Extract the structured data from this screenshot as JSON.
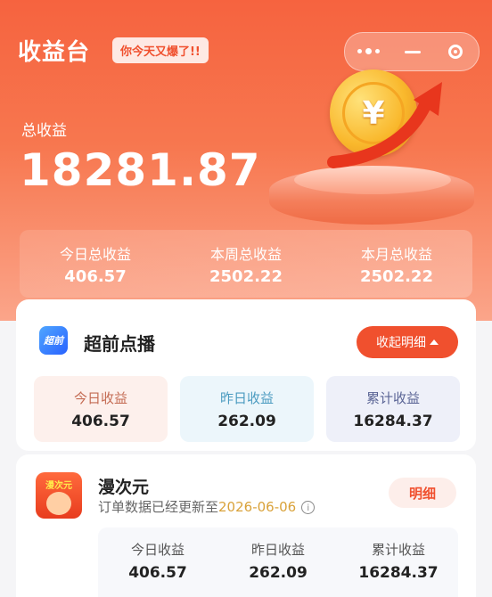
{
  "header": {
    "title": "收益台",
    "slogan": "你今天又爆了!!"
  },
  "capsule": {
    "more_icon": "more-dots-icon",
    "minimize_icon": "minus-icon",
    "close_icon": "target-icon"
  },
  "total": {
    "label": "总收益",
    "value": "18281.87"
  },
  "summary": [
    {
      "label": "今日总收益",
      "value": "406.57"
    },
    {
      "label": "本周总收益",
      "value": "2502.22"
    },
    {
      "label": "本月总收益",
      "value": "2502.22"
    }
  ],
  "card1": {
    "icon_text": "超前",
    "name": "超前点播",
    "button_label": "收起明细",
    "stats": [
      {
        "label": "今日收益",
        "value": "406.57"
      },
      {
        "label": "昨日收益",
        "value": "262.09"
      },
      {
        "label": "累计收益",
        "value": "16284.37"
      }
    ]
  },
  "card2": {
    "icon_text": "漫次元",
    "name": "漫次元",
    "update_text": "订单数据已经更新至",
    "update_date": "2026-06-06",
    "button_label": "明细",
    "stats": [
      {
        "label": "今日收益",
        "value": "406.57"
      },
      {
        "label": "昨日收益",
        "value": "262.09"
      },
      {
        "label": "累计收益",
        "value": "16284.37"
      }
    ]
  },
  "colors": {
    "accent": "#f0502e",
    "hero_top": "#f6633f",
    "date_highlight": "#d9a23a"
  }
}
